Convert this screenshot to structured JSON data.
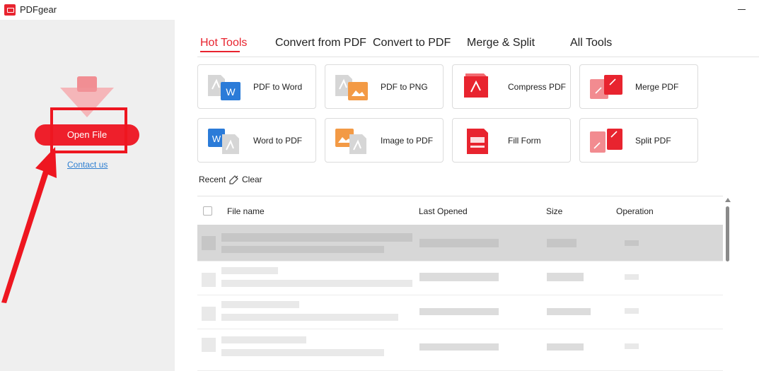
{
  "app": {
    "title": "PDFgear",
    "icon": "pdfgear-logo-icon"
  },
  "sidebar": {
    "open_file_label": "Open File",
    "contact_label": "Contact us",
    "accent": "#ee1f2b"
  },
  "tabs": [
    {
      "label": "Hot Tools",
      "active": true
    },
    {
      "label": "Convert from PDF",
      "active": false
    },
    {
      "label": "Convert to PDF",
      "active": false
    },
    {
      "label": "Merge & Split",
      "active": false
    },
    {
      "label": "All Tools",
      "active": false
    }
  ],
  "tools": [
    {
      "label": "PDF to Word",
      "icon": "pdf-to-word-icon"
    },
    {
      "label": "PDF to PNG",
      "icon": "pdf-to-png-icon"
    },
    {
      "label": "Compress PDF",
      "icon": "compress-pdf-icon"
    },
    {
      "label": "Merge PDF",
      "icon": "merge-pdf-icon"
    },
    {
      "label": "Word to PDF",
      "icon": "word-to-pdf-icon"
    },
    {
      "label": "Image to PDF",
      "icon": "image-to-pdf-icon"
    },
    {
      "label": "Fill Form",
      "icon": "fill-form-icon"
    },
    {
      "label": "Split PDF",
      "icon": "split-pdf-icon"
    }
  ],
  "recent": {
    "label": "Recent",
    "clear_label": "Clear",
    "columns": [
      "File name",
      "Last Opened",
      "Size",
      "Operation"
    ]
  }
}
